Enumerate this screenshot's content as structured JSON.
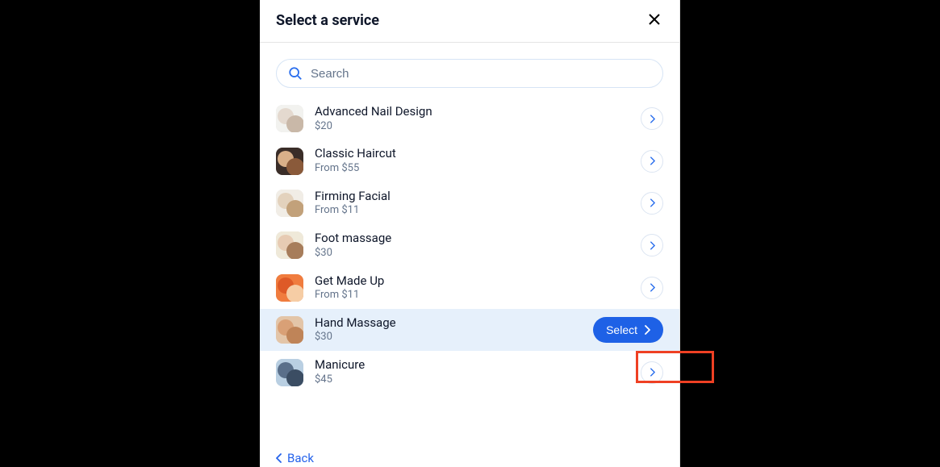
{
  "modal": {
    "title": "Select a service",
    "search_placeholder": "Search"
  },
  "services": [
    {
      "name": "Advanced Nail Design",
      "price": "$20",
      "selected": false,
      "thumb": "nail"
    },
    {
      "name": "Classic Haircut",
      "price": "From $55",
      "selected": false,
      "thumb": "haircut"
    },
    {
      "name": "Firming Facial",
      "price": "From $11",
      "selected": false,
      "thumb": "facial"
    },
    {
      "name": "Foot massage",
      "price": "$30",
      "selected": false,
      "thumb": "foot"
    },
    {
      "name": "Get Made Up",
      "price": "From $11",
      "selected": false,
      "thumb": "makeup"
    },
    {
      "name": "Hand Massage",
      "price": "$30",
      "selected": true,
      "thumb": "hand"
    },
    {
      "name": "Manicure",
      "price": "$45",
      "selected": false,
      "thumb": "manicure"
    }
  ],
  "actions": {
    "select_label": "Select",
    "back_label": "Back"
  },
  "colors": {
    "accent": "#1e61e6",
    "highlight": "#ef4023",
    "selected_bg": "#e6f0fb"
  }
}
